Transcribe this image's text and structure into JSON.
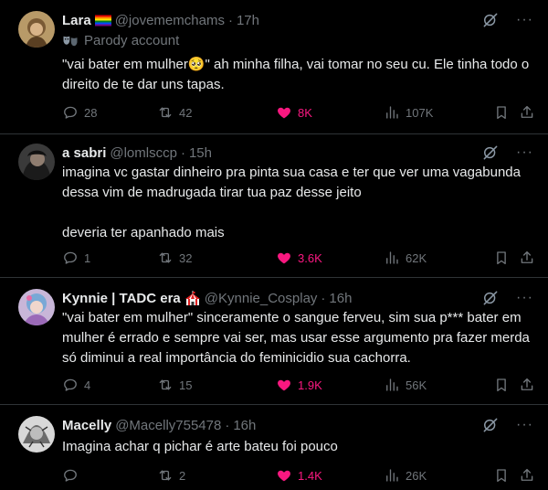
{
  "colors": {
    "background": "#000000",
    "text": "#e7e9ea",
    "secondary": "#71767b",
    "like": "#f91880",
    "divider": "#2f3336"
  },
  "tweets": [
    {
      "name": "Lara",
      "name_emoji": "rainbow-flag",
      "handle": "@jovememchams",
      "time": "17h",
      "parody_label": "Parody account",
      "text": "\"vai bater em mulher🥺\" ah minha filha, vai tomar no seu cu. Ele tinha todo o direito de te dar uns tapas.",
      "replies": "28",
      "retweets": "42",
      "likes": "8K",
      "views": "107K",
      "liked": true
    },
    {
      "name": "a sabri",
      "handle": "@lomlsccp",
      "time": "15h",
      "text": "imagina vc gastar dinheiro pra pinta sua casa e ter que ver uma vagabunda dessa vim de madrugada tirar tua paz desse jeito\n\ndeveria ter apanhado mais",
      "replies": "1",
      "retweets": "32",
      "likes": "3.6K",
      "views": "62K",
      "liked": true
    },
    {
      "name": "Kynnie | TADC era",
      "name_emoji": "circus-tent",
      "handle": "@Kynnie_Cosplay",
      "time": "16h",
      "text": "\"vai bater em mulher\" sinceramente o sangue ferveu, sim sua p*** bater em mulher é errado e sempre vai ser, mas usar esse argumento pra fazer merda só diminui a real importância do feminicidio sua cachorra.",
      "replies": "4",
      "retweets": "15",
      "likes": "1.9K",
      "views": "56K",
      "liked": true
    },
    {
      "name": "Macelly",
      "handle": "@Macelly755478",
      "time": "16h",
      "text": "Imagina achar q pichar é arte bateu foi pouco",
      "replies": "",
      "retweets": "2",
      "likes": "1.4K",
      "views": "26K",
      "liked": true
    }
  ]
}
